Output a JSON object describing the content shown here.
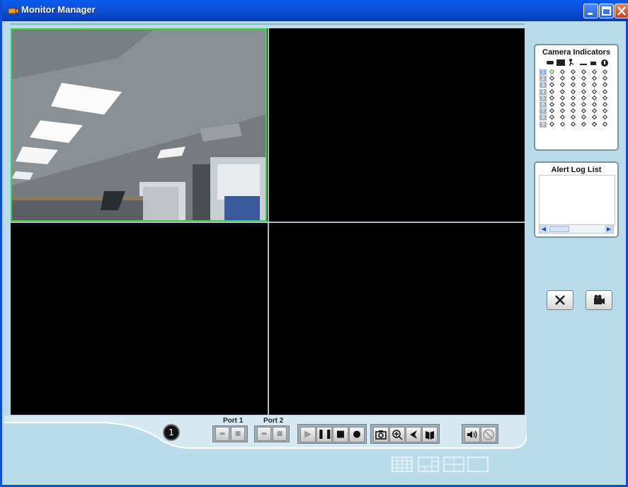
{
  "window": {
    "title": "Monitor Manager"
  },
  "camera_panel": {
    "title": "Camera Indicators",
    "rows": [
      "1",
      "2",
      "3",
      "4",
      "5",
      "6",
      "7",
      "8",
      "9"
    ],
    "columns": [
      "link-icon",
      "video-icon",
      "motion-icon",
      "sensor-icon",
      "record-icon",
      "alarm-icon"
    ]
  },
  "alert_panel": {
    "title": "Alert Log List"
  },
  "controls": {
    "channel_number": "1",
    "port1_label": "Port 1",
    "port2_label": "Port 2"
  },
  "colors": {
    "active_border": "#3fcf4a",
    "titlebar": "#0a5bf0",
    "background": "#b9dbea"
  }
}
